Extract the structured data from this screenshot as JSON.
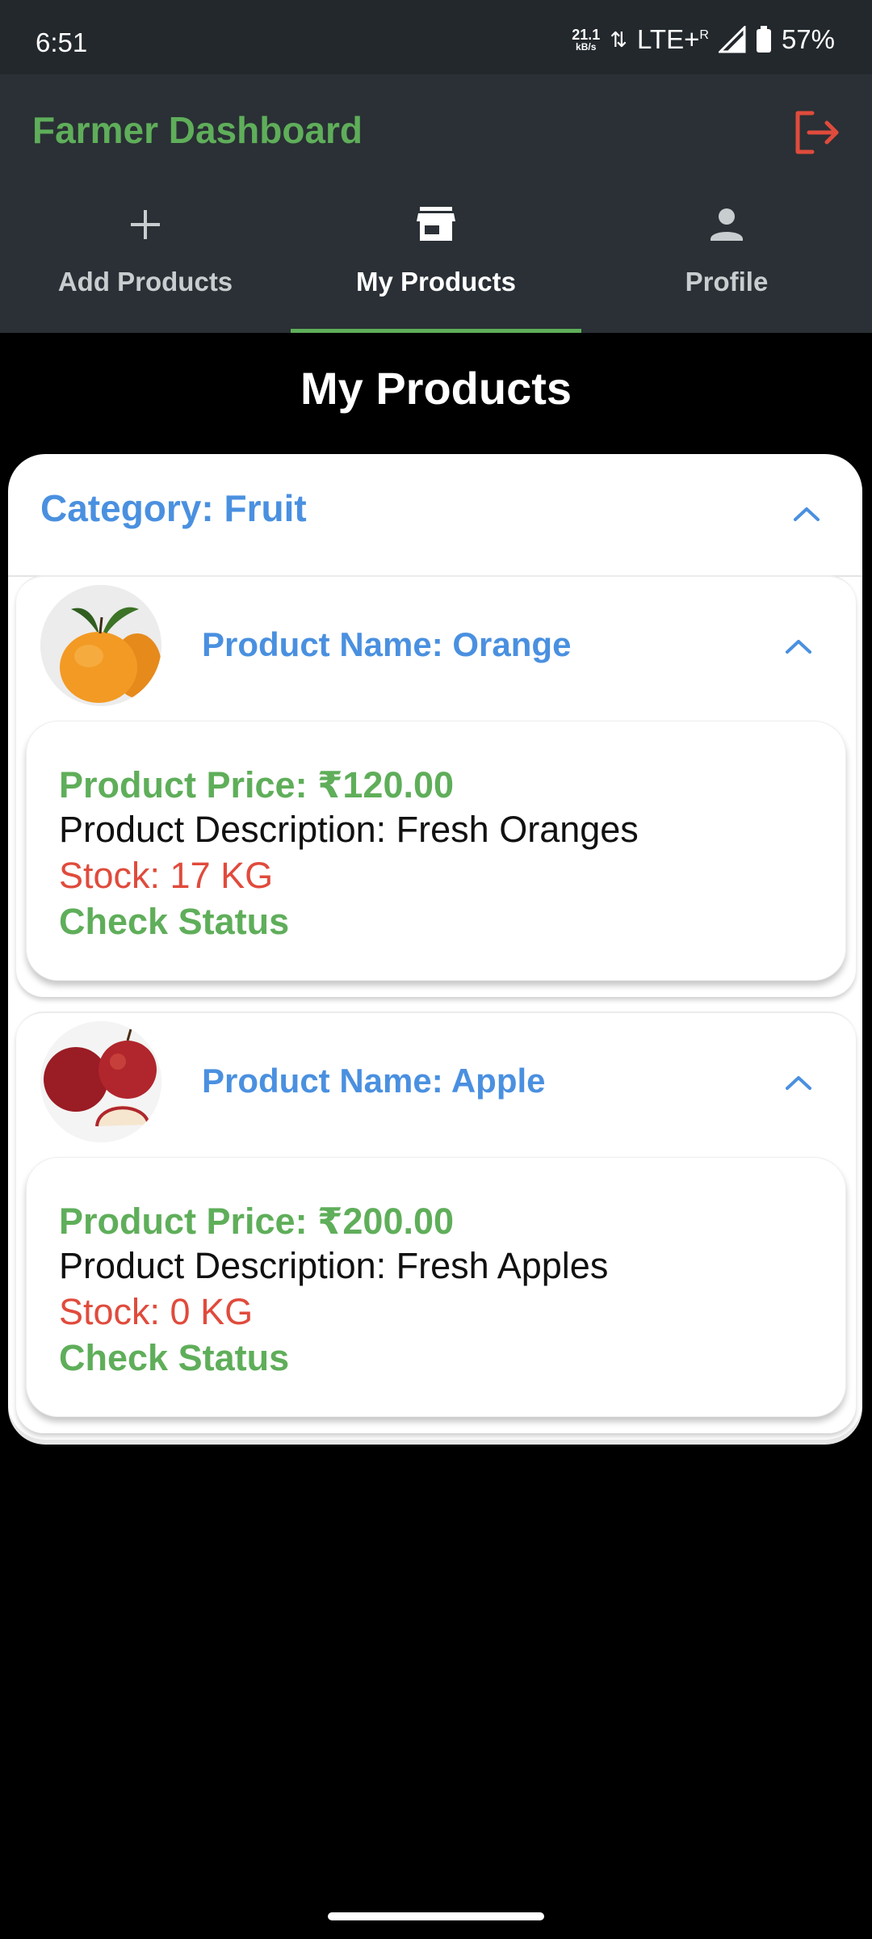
{
  "status_bar": {
    "time": "6:51",
    "net_speed_value": "21.1",
    "net_speed_unit": "kB/s",
    "network": "LTE+",
    "roaming": "R",
    "battery": "57%"
  },
  "app_bar": {
    "title": "Farmer Dashboard",
    "logout_icon": "logout-icon",
    "title_color": "#5fae5a",
    "logout_color": "#e04b3c"
  },
  "tabs": [
    {
      "label": "Add Products",
      "icon": "plus-icon",
      "active": false
    },
    {
      "label": "My Products",
      "icon": "store-icon",
      "active": true
    },
    {
      "label": "Profile",
      "icon": "person-icon",
      "active": false
    }
  ],
  "page_title": "My Products",
  "category": {
    "title": "Category: Fruit",
    "products": [
      {
        "name": "Product Name: Orange",
        "image": "orange-image",
        "price": "Product Price: ₹120.00",
        "description": "Product Description: Fresh Oranges",
        "stock": "Stock: 17 KG",
        "status_link": "Check Status"
      },
      {
        "name": "Product Name: Apple",
        "image": "apple-image",
        "price": "Product Price: ₹200.00",
        "description": "Product Description: Fresh Apples",
        "stock": "Stock: 0 KG",
        "status_link": "Check Status"
      }
    ]
  },
  "colors": {
    "accent_green": "#5fae5a",
    "link_blue": "#4a90e0",
    "stock_red": "#e04b3c"
  }
}
